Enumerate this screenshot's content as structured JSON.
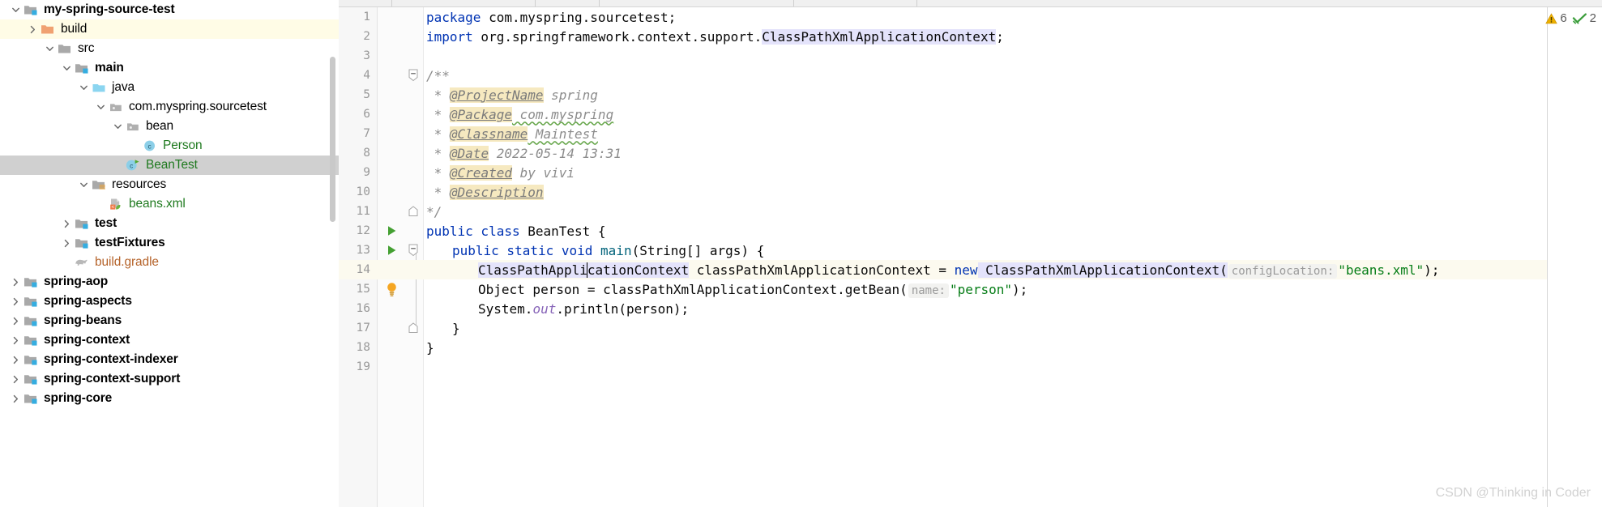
{
  "project_tree": {
    "name": "project-tool-window",
    "scrollbar": {
      "visible": true
    },
    "items": [
      {
        "label": "my-spring-source-test",
        "indent": 0,
        "chevron": "down",
        "icon": "module-folder-icon",
        "bold": true,
        "color": "default",
        "state": "normal"
      },
      {
        "label": "build",
        "indent": 1,
        "chevron": "right",
        "icon": "excluded-folder-icon",
        "bold": false,
        "color": "default",
        "state": "hover-yellow"
      },
      {
        "label": "src",
        "indent": 2,
        "chevron": "down",
        "icon": "folder-icon",
        "bold": false,
        "color": "default",
        "state": "normal"
      },
      {
        "label": "main",
        "indent": 3,
        "chevron": "down",
        "icon": "module-folder-icon",
        "bold": true,
        "color": "default",
        "state": "normal"
      },
      {
        "label": "java",
        "indent": 4,
        "chevron": "down",
        "icon": "source-root-icon",
        "bold": false,
        "color": "default",
        "state": "normal"
      },
      {
        "label": "com.myspring.sourcetest",
        "indent": 5,
        "chevron": "down",
        "icon": "package-icon",
        "bold": false,
        "color": "default",
        "state": "normal"
      },
      {
        "label": "bean",
        "indent": 6,
        "chevron": "down",
        "icon": "package-icon",
        "bold": false,
        "color": "default",
        "state": "normal"
      },
      {
        "label": "Person",
        "indent": 7,
        "chevron": "none",
        "icon": "java-class-icon",
        "bold": false,
        "color": "green",
        "state": "normal"
      },
      {
        "label": "BeanTest",
        "indent": 6,
        "chevron": "none",
        "icon": "java-runnable-class-icon",
        "bold": false,
        "color": "green",
        "state": "selected"
      },
      {
        "label": "resources",
        "indent": 4,
        "chevron": "down",
        "icon": "resources-root-icon",
        "bold": false,
        "color": "default",
        "state": "normal"
      },
      {
        "label": "beans.xml",
        "indent": 5,
        "chevron": "none",
        "icon": "spring-xml-icon",
        "bold": false,
        "color": "green",
        "state": "normal"
      },
      {
        "label": "test",
        "indent": 3,
        "chevron": "right",
        "icon": "module-folder-icon",
        "bold": true,
        "color": "default",
        "state": "normal"
      },
      {
        "label": "testFixtures",
        "indent": 3,
        "chevron": "right",
        "icon": "module-folder-icon",
        "bold": true,
        "color": "default",
        "state": "normal"
      },
      {
        "label": "build.gradle",
        "indent": 3,
        "chevron": "none",
        "icon": "gradle-elephant-icon",
        "bold": false,
        "color": "orange",
        "state": "normal"
      },
      {
        "label": "spring-aop",
        "indent": 0,
        "chevron": "right",
        "icon": "module-folder-icon",
        "bold": true,
        "color": "default",
        "state": "normal"
      },
      {
        "label": "spring-aspects",
        "indent": 0,
        "chevron": "right",
        "icon": "module-folder-icon",
        "bold": true,
        "color": "default",
        "state": "normal"
      },
      {
        "label": "spring-beans",
        "indent": 0,
        "chevron": "right",
        "icon": "module-folder-icon",
        "bold": true,
        "color": "default",
        "state": "normal"
      },
      {
        "label": "spring-context",
        "indent": 0,
        "chevron": "right",
        "icon": "module-folder-icon",
        "bold": true,
        "color": "default",
        "state": "normal"
      },
      {
        "label": "spring-context-indexer",
        "indent": 0,
        "chevron": "right",
        "icon": "module-folder-icon",
        "bold": true,
        "color": "default",
        "state": "normal"
      },
      {
        "label": "spring-context-support",
        "indent": 0,
        "chevron": "right",
        "icon": "module-folder-icon",
        "bold": true,
        "color": "default",
        "state": "normal"
      },
      {
        "label": "spring-core",
        "indent": 0,
        "chevron": "right",
        "icon": "module-folder-icon",
        "bold": true,
        "color": "default",
        "state": "normal"
      }
    ]
  },
  "editor": {
    "current_line": 14,
    "lines": [
      {
        "n": "1",
        "gutter": "none",
        "fold": "none"
      },
      {
        "n": "2",
        "gutter": "none",
        "fold": "none"
      },
      {
        "n": "3",
        "gutter": "none",
        "fold": "none"
      },
      {
        "n": "4",
        "gutter": "none",
        "fold": "minus"
      },
      {
        "n": "5",
        "gutter": "none",
        "fold": "none"
      },
      {
        "n": "6",
        "gutter": "none",
        "fold": "none"
      },
      {
        "n": "7",
        "gutter": "none",
        "fold": "none"
      },
      {
        "n": "8",
        "gutter": "none",
        "fold": "none"
      },
      {
        "n": "9",
        "gutter": "none",
        "fold": "none"
      },
      {
        "n": "10",
        "gutter": "none",
        "fold": "none"
      },
      {
        "n": "11",
        "gutter": "none",
        "fold": "end"
      },
      {
        "n": "12",
        "gutter": "run",
        "fold": "none"
      },
      {
        "n": "13",
        "gutter": "run",
        "fold": "minus"
      },
      {
        "n": "14",
        "gutter": "none",
        "fold": "none"
      },
      {
        "n": "15",
        "gutter": "lightbulb",
        "fold": "none"
      },
      {
        "n": "16",
        "gutter": "none",
        "fold": "none"
      },
      {
        "n": "17",
        "gutter": "none",
        "fold": "end"
      },
      {
        "n": "18",
        "gutter": "none",
        "fold": "none"
      },
      {
        "n": "19",
        "gutter": "none",
        "fold": "none"
      }
    ],
    "code": {
      "l1_kw": "package",
      "l1_rest": " com.myspring.sourcetest;",
      "l2_kw": "import",
      "l2_rest": " org.springframework.context.support.",
      "l2_cls": "ClassPathXmlApplicationContext",
      "l2_semi": ";",
      "l4": "/**",
      "l5_star": " * ",
      "l5_tag": "@ProjectName",
      "l5_val": " spring",
      "l6_star": " * ",
      "l6_tag": "@Package",
      "l6_val": " com.myspring",
      "l7_star": " * ",
      "l7_tag": "@Classname",
      "l7_val": " Maintest",
      "l8_star": " * ",
      "l8_tag": "@Date",
      "l8_val": " 2022-05-14 13:31",
      "l9_star": " * ",
      "l9_tag": "@Created",
      "l9_val": " by vivi",
      "l10_star": " * ",
      "l10_tag": "@Description",
      "l11": "*/",
      "l12_kw1": "public",
      "l12_kw2": " class",
      "l12_name": " BeanTest",
      "l12_brace": " {",
      "l13_kw1": "public",
      "l13_kw2": " static",
      "l13_kw3": " void",
      "l13_name": " main",
      "l13_args": "(String[] args) {",
      "l14_type": "ClassPathXmlApplicationContext",
      "l14_var": " classPathXmlApplicationContext = ",
      "l14_new": "new",
      "l14_ctor": " ClassPathXmlApplicationContext(",
      "l14_hint": "configLocation:",
      "l14_str": "\"beans.xml\"",
      "l14_tail": ");",
      "l15_type": "Object",
      "l15_mid": " person = classPathXmlApplicationContext.getBean(",
      "l15_hint": "name:",
      "l15_str": "\"person\"",
      "l15_tail": ");",
      "l16_sys": "System.",
      "l16_out": "out",
      "l16_rest": ".println(person);",
      "l17": "}",
      "l18": "}"
    }
  },
  "inspection_widget": {
    "warning_icon": "warning-triangle-icon",
    "warning_count": "6",
    "ok_icon": "double-check-icon",
    "ok_count": "2"
  },
  "watermark": {
    "text": "CSDN @Thinking in Coder"
  },
  "colors": {
    "keyword": "#0033B3",
    "string": "#067D17",
    "comment": "#8C8C8C",
    "javadoc_tag_bg": "#F6E9C0",
    "caret_line_bg": "#FCFAEF",
    "identifier_highlight": "#E4E3FB",
    "selection_row": "#D0D0D0",
    "hover_row": "#FFFCE6",
    "warning": "#E5A000",
    "ok": "#4CA64C",
    "tree_green": "#1F7A1F",
    "tree_orange": "#B5632A"
  }
}
